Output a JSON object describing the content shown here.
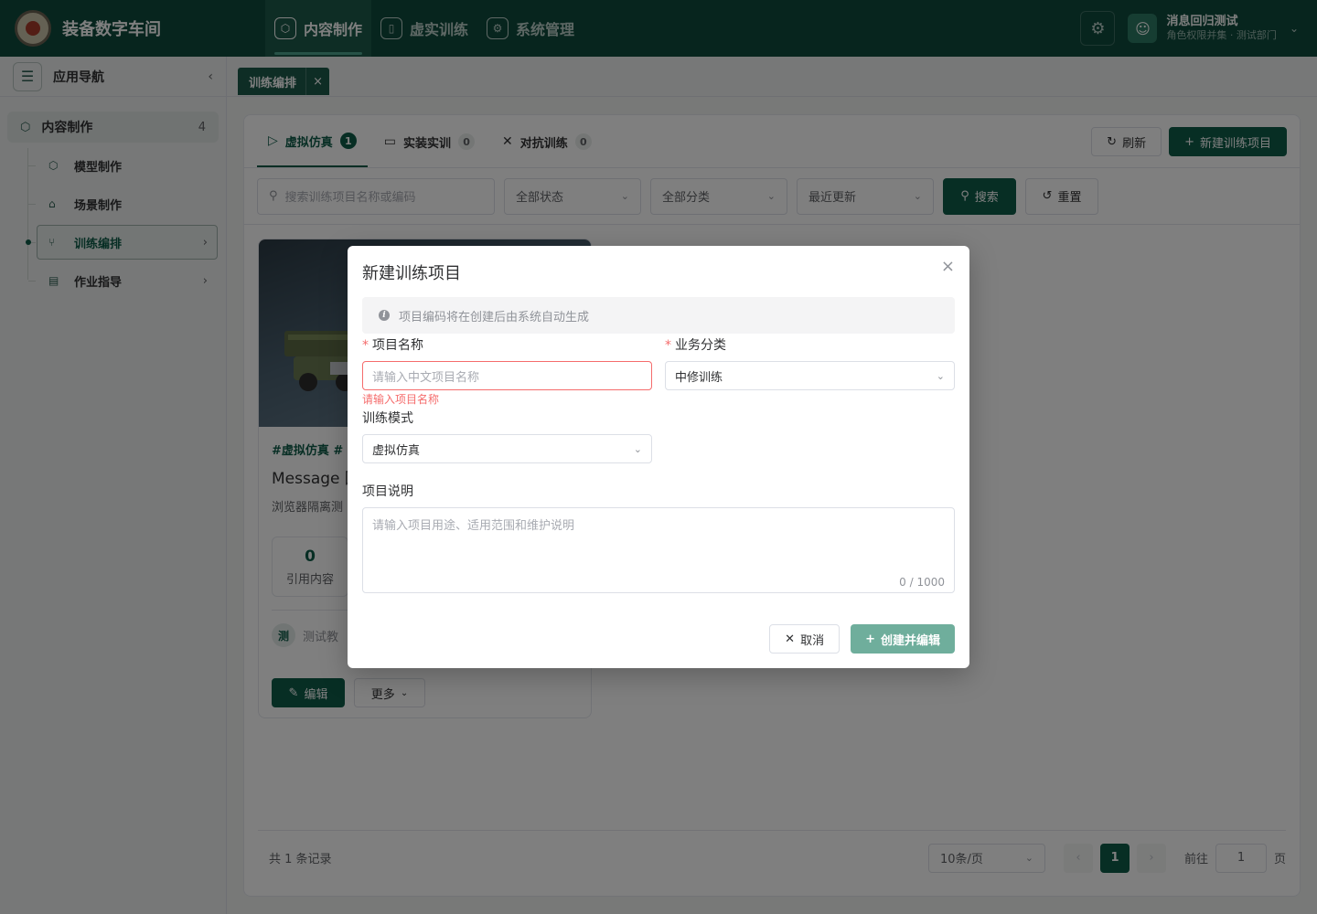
{
  "app": {
    "title": "装备数字车间"
  },
  "top_nav": {
    "items": [
      {
        "label": "内容制作",
        "icon": "cube-icon",
        "active": true
      },
      {
        "label": "虚实训练",
        "icon": "book-icon",
        "active": false
      },
      {
        "label": "系统管理",
        "icon": "gear-icon",
        "active": false
      }
    ]
  },
  "user": {
    "name": "消息回归测试",
    "subtitle": "角色权限并集 · 测试部门"
  },
  "sidebar": {
    "title": "应用导航",
    "group": {
      "label": "内容制作",
      "count": "4"
    },
    "items": [
      {
        "label": "模型制作",
        "icon": "cube-icon"
      },
      {
        "label": "场景制作",
        "icon": "bank-icon"
      },
      {
        "label": "训练编排",
        "icon": "flow-icon",
        "active": true
      },
      {
        "label": "作业指导",
        "icon": "document-icon"
      }
    ]
  },
  "tabstrip": {
    "active_tab": "训练编排"
  },
  "panel": {
    "tabs": [
      {
        "label": "虚拟仿真",
        "count": "1",
        "icon": "play-icon",
        "active": true
      },
      {
        "label": "实装实训",
        "count": "0",
        "icon": "monitor-icon",
        "active": false
      },
      {
        "label": "对抗训练",
        "count": "0",
        "icon": "versus-icon",
        "active": false
      }
    ],
    "refresh_label": "刷新",
    "new_label": "新建训练项目"
  },
  "filters": {
    "search_placeholder": "搜索训练项目名称或编码",
    "status": "全部状态",
    "category": "全部分类",
    "sort": "最近更新",
    "search_btn": "搜索",
    "reset_btn": "重置"
  },
  "card": {
    "tags": "#虚拟仿真 #",
    "title": "Message 回",
    "desc": "浏览器隔离测",
    "stat_num": "0",
    "stat_label": "引用内容",
    "owner_initial": "测",
    "owner_name": "测试教",
    "edit_label": "编辑",
    "more_label": "更多"
  },
  "pager": {
    "total": "共 1 条记录",
    "page_size": "10条/页",
    "current_page": "1",
    "goto_prefix": "前往",
    "goto_value": "1",
    "goto_suffix": "页"
  },
  "modal": {
    "title": "新建训练项目",
    "notice": "项目编码将在创建后由系统自动生成",
    "name_label": "项目名称",
    "name_placeholder": "请输入中文项目名称",
    "name_error": "请输入项目名称",
    "category_label": "业务分类",
    "category_value": "中修训练",
    "mode_label": "训练模式",
    "mode_value": "虚拟仿真",
    "desc_label": "项目说明",
    "desc_placeholder": "请输入项目用途、适用范围和维护说明",
    "desc_count": "0 / 1000",
    "cancel_label": "取消",
    "create_label": "创建并编辑"
  },
  "colors": {
    "brand": "#0f4a3c",
    "primary": "#0f5c49",
    "error": "#f56c6c"
  }
}
